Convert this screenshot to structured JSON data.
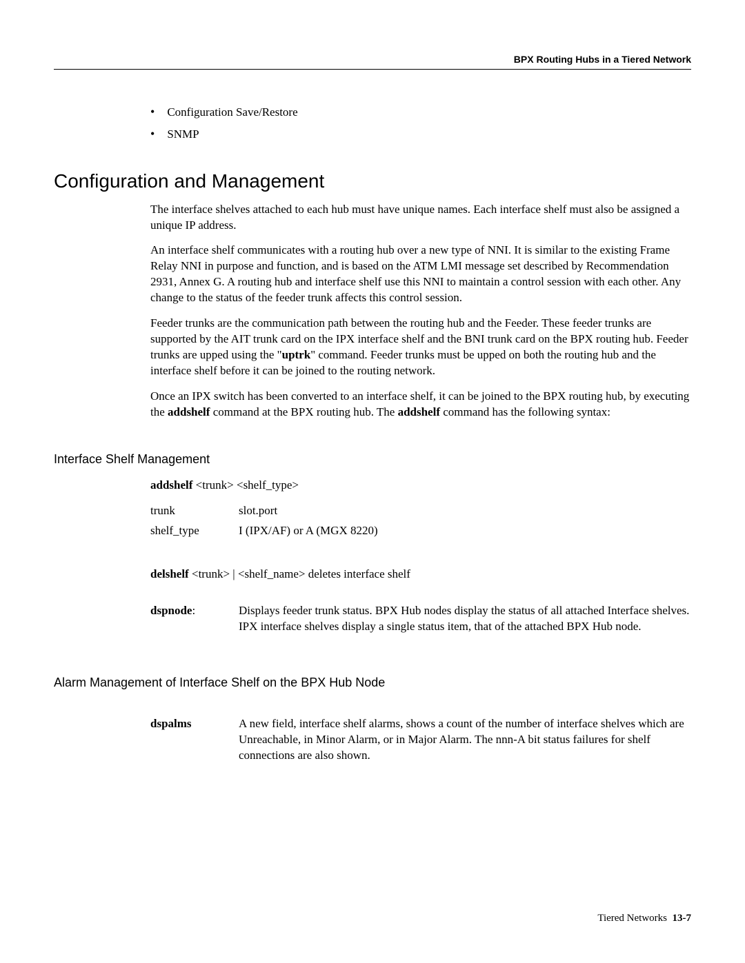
{
  "header": {
    "title": "BPX Routing Hubs in a Tiered Network"
  },
  "bullets": [
    "Configuration Save/Restore",
    "SNMP"
  ],
  "section": {
    "title": "Configuration and Management",
    "paragraphs": [
      "The interface shelves attached to each hub must have unique names. Each interface shelf must also be assigned a unique IP address.",
      "An interface shelf communicates with a routing hub over a new type of NNI. It is similar to the existing Frame Relay NNI in purpose and function, and is based on the ATM LMI message set described by Recommendation 2931, Annex G. A routing hub and interface shelf use this NNI to maintain a control session with each other. Any change to the status of the feeder trunk affects this control session."
    ],
    "feeder_para": {
      "pre": "Feeder trunks are the communication path between the routing hub and the Feeder. These feeder trunks are supported by the AIT trunk card on the IPX interface shelf and the BNI trunk card on the BPX routing hub. Feeder trunks are upped using the \"",
      "bold": "uptrk",
      "post": "\" command. Feeder trunks must be upped on both the routing hub and the interface shelf before it can be joined to the routing network."
    },
    "addshelf_para": {
      "pre1": "Once an IPX switch has been converted to an interface shelf, it can be joined to the BPX routing hub, by executing the ",
      "bold1": "addshelf",
      "mid": " command at the BPX routing hub. The ",
      "bold2": "addshelf",
      "post": " command has the following syntax:"
    }
  },
  "interface_shelf": {
    "title": "Interface Shelf Management",
    "syntax": {
      "cmd": "addshelf",
      "args": " <trunk> <shelf_type>"
    },
    "params": [
      {
        "name": "trunk",
        "desc": "slot.port"
      },
      {
        "name": "shelf_type",
        "desc": "I (IPX/AF) or A (MGX 8220)"
      }
    ],
    "delshelf": {
      "cmd": "delshelf",
      "args": " <trunk> | <shelf_name>",
      "desc": "   deletes interface shelf"
    },
    "dspnode": {
      "label": "dspnode",
      "suffix": ":",
      "desc": "Displays feeder trunk status. BPX Hub nodes display the status of all attached Interface shelves. IPX interface shelves display a single status item, that of the attached BPX Hub node."
    }
  },
  "alarm": {
    "title": "Alarm Management of Interface Shelf on the BPX Hub Node",
    "dspalms": {
      "label": "dspalms",
      "desc": "A new field, interface shelf alarms, shows a count of the number of interface shelves which are Unreachable, in Minor Alarm, or in Major Alarm. The nnn-A bit status failures for shelf connections are also shown."
    }
  },
  "footer": {
    "label": "Tiered Networks",
    "page": "13-7"
  }
}
